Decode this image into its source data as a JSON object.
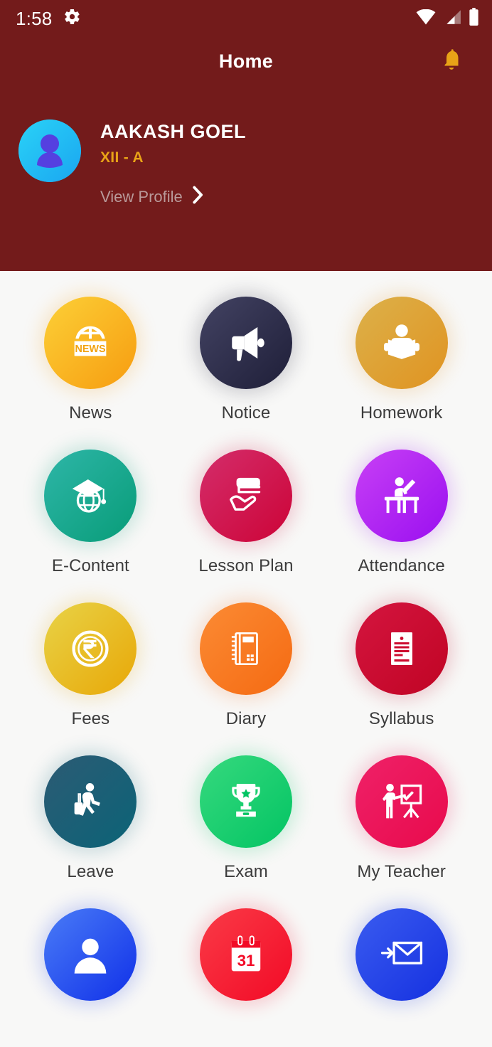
{
  "statusbar": {
    "time": "1:58",
    "icons": [
      "gear-icon",
      "wifi-icon",
      "cellular-signal-icon",
      "battery-icon"
    ]
  },
  "header": {
    "title": "Home",
    "background_color": "#731b1b",
    "notification_icon": "bell-icon",
    "notification_color": "#e8a317"
  },
  "profile": {
    "avatar_icon": "user-avatar",
    "name": "AAKASH GOEL",
    "class": "XII - A",
    "class_color": "#e8a317",
    "view_profile_label": "View Profile",
    "chevron_icon": "chevron-right-icon"
  },
  "menu": {
    "items": [
      {
        "label": "News",
        "icon": "news-globe-icon",
        "c1": "#fcd037",
        "c2": "#f79c10"
      },
      {
        "label": "Notice",
        "icon": "megaphone-icon",
        "c1": "#434363",
        "c2": "#1e1e38"
      },
      {
        "label": "Homework",
        "icon": "person-reading-icon",
        "c1": "#dcb14a",
        "c2": "#e09321"
      },
      {
        "label": "E-Content",
        "icon": "graduation-globe-icon",
        "c1": "#2eb6a8",
        "c2": "#089c78"
      },
      {
        "label": "Lesson Plan",
        "icon": "hand-book-icon",
        "c1": "#d42d6b",
        "c2": "#cc0437"
      },
      {
        "label": "Attendance",
        "icon": "student-desk-icon",
        "c1": "#c840f5",
        "c2": "#9a0ff0"
      },
      {
        "label": "Fees",
        "icon": "rupee-coin-icon",
        "c1": "#e8d347",
        "c2": "#e8a707"
      },
      {
        "label": "Diary",
        "icon": "notebook-icon",
        "c1": "#fb8b34",
        "c2": "#f56a12"
      },
      {
        "label": "Syllabus",
        "icon": "document-lines-icon",
        "c1": "#d4153f",
        "c2": "#c00424"
      },
      {
        "label": "Leave",
        "icon": "traveler-suitcase-icon",
        "c1": "#2c5b74",
        "c2": "#0b6377"
      },
      {
        "label": "Exam",
        "icon": "trophy-icon",
        "c1": "#36d97e",
        "c2": "#03c463"
      },
      {
        "label": "My Teacher",
        "icon": "teacher-board-icon",
        "c1": "#ef2168",
        "c2": "#e80a4c"
      },
      {
        "label": "",
        "icon": "person-icon",
        "c1": "#4a7cf7",
        "c2": "#1030e8"
      },
      {
        "label": "",
        "icon": "calendar-31-icon",
        "c1": "#fa3b47",
        "c2": "#f20a26",
        "calendar_day": "31"
      },
      {
        "label": "",
        "icon": "envelope-arrow-icon",
        "c1": "#3a5cf0",
        "c2": "#1530e0"
      }
    ]
  },
  "theme": {
    "body_background": "#f8f8f7",
    "label_color": "#3c3c3c"
  }
}
